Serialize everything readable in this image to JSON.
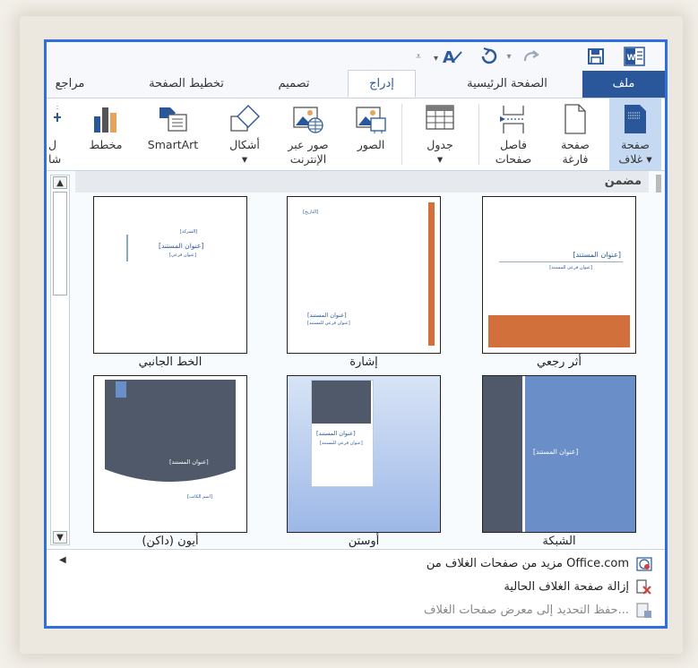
{
  "quick_access": {
    "icons": [
      "customize-arrow-icon",
      "font-color-icon",
      "undo-icon",
      "redo-icon",
      "save-icon",
      "word-icon"
    ]
  },
  "tabs": [
    {
      "label": "ملف",
      "name": "file"
    },
    {
      "label": "الصفحة الرئيسية",
      "name": "home"
    },
    {
      "label": "إدراج",
      "name": "insert"
    },
    {
      "label": "تصميم",
      "name": "design"
    },
    {
      "label": "تخطيط الصفحة",
      "name": "page-layout"
    },
    {
      "label": "مراجع",
      "name": "references"
    }
  ],
  "ribbon": {
    "cover_page": "صفحة\nغلاف ▾",
    "blank_page": "صفحة\nفارغة",
    "page_break": "فاصل\nصفحات",
    "table": "جدول\n▾",
    "pictures": "الصور",
    "online_pictures": "صور عبر\nالإنترنت",
    "shapes": "أشكال\n▾",
    "smartart": "SmartArt",
    "chart": "مخطط",
    "partial": "ل\nشا"
  },
  "gallery": {
    "header": "مضمن",
    "items": [
      {
        "label": "أثر رجعي",
        "title": "[عنوان المستند]"
      },
      {
        "label": "إشارة",
        "title": "[عنوان المستند]"
      },
      {
        "label": "الخط الجانبي",
        "title": "[عنوان المستند]"
      },
      {
        "label": "الشبكة",
        "title": "[عنوان المستند]"
      },
      {
        "label": "أوستن",
        "title": "[عنوان المستند]"
      },
      {
        "label": "أيون (داكن)",
        "title": "[عنوان المستند]"
      }
    ]
  },
  "menu": {
    "more": "مزيد من صفحات الغلاف من Office.com",
    "remove": "إزالة صفحة الغلاف الحالية",
    "save": "حفظ التحديد إلى معرض صفحات الغلاف..."
  },
  "colors": {
    "accent": "#2a579a",
    "frame": "#2f6fe0",
    "retro_orange": "#d2703c",
    "grid_blue": "#6a8fc8",
    "ion_dark": "#50596a"
  }
}
